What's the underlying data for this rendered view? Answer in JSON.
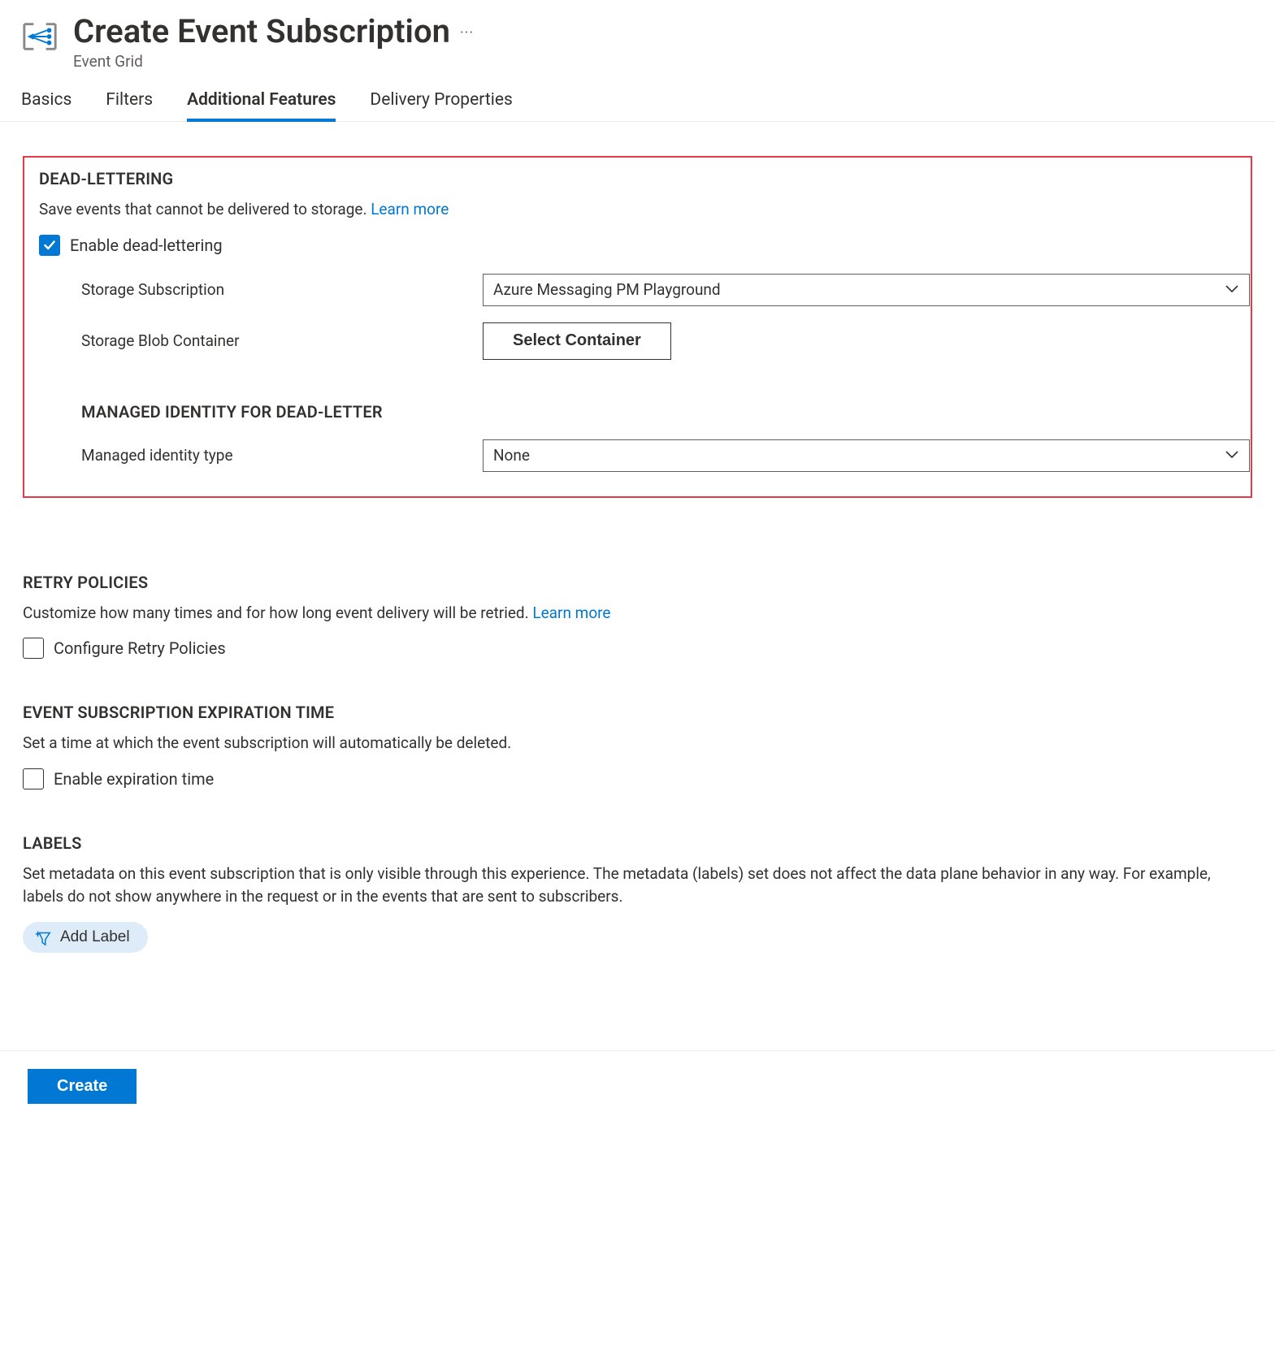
{
  "header": {
    "title": "Create Event Subscription",
    "subtitle": "Event Grid"
  },
  "tabs": {
    "items": [
      {
        "label": "Basics"
      },
      {
        "label": "Filters"
      },
      {
        "label": "Additional Features"
      },
      {
        "label": "Delivery Properties"
      }
    ],
    "active": 2
  },
  "deadLettering": {
    "title": "DEAD-LETTERING",
    "desc": "Save events that cannot be delivered to storage. ",
    "learnMore": "Learn more",
    "enableLabel": "Enable dead-lettering",
    "storageSubscription": {
      "label": "Storage Subscription",
      "value": "Azure Messaging PM Playground"
    },
    "storageBlobContainer": {
      "label": "Storage Blob Container",
      "buttonLabel": "Select Container"
    },
    "managedIdentity": {
      "title": "MANAGED IDENTITY FOR DEAD-LETTER",
      "typeLabel": "Managed identity type",
      "value": "None"
    }
  },
  "retryPolicies": {
    "title": "RETRY POLICIES",
    "desc": "Customize how many times and for how long event delivery will be retried. ",
    "learnMore": "Learn more",
    "configureLabel": "Configure Retry Policies"
  },
  "expiration": {
    "title": "EVENT SUBSCRIPTION EXPIRATION TIME",
    "desc": "Set a time at which the event subscription will automatically be deleted.",
    "enableLabel": "Enable expiration time"
  },
  "labels": {
    "title": "LABELS",
    "desc": "Set metadata on this event subscription that is only visible through this experience. The metadata (labels) set does not affect the data plane behavior in any way. For example, labels do not show anywhere in the request or in the events that are sent to subscribers.",
    "addLabel": "Add Label"
  },
  "footer": {
    "createLabel": "Create"
  }
}
